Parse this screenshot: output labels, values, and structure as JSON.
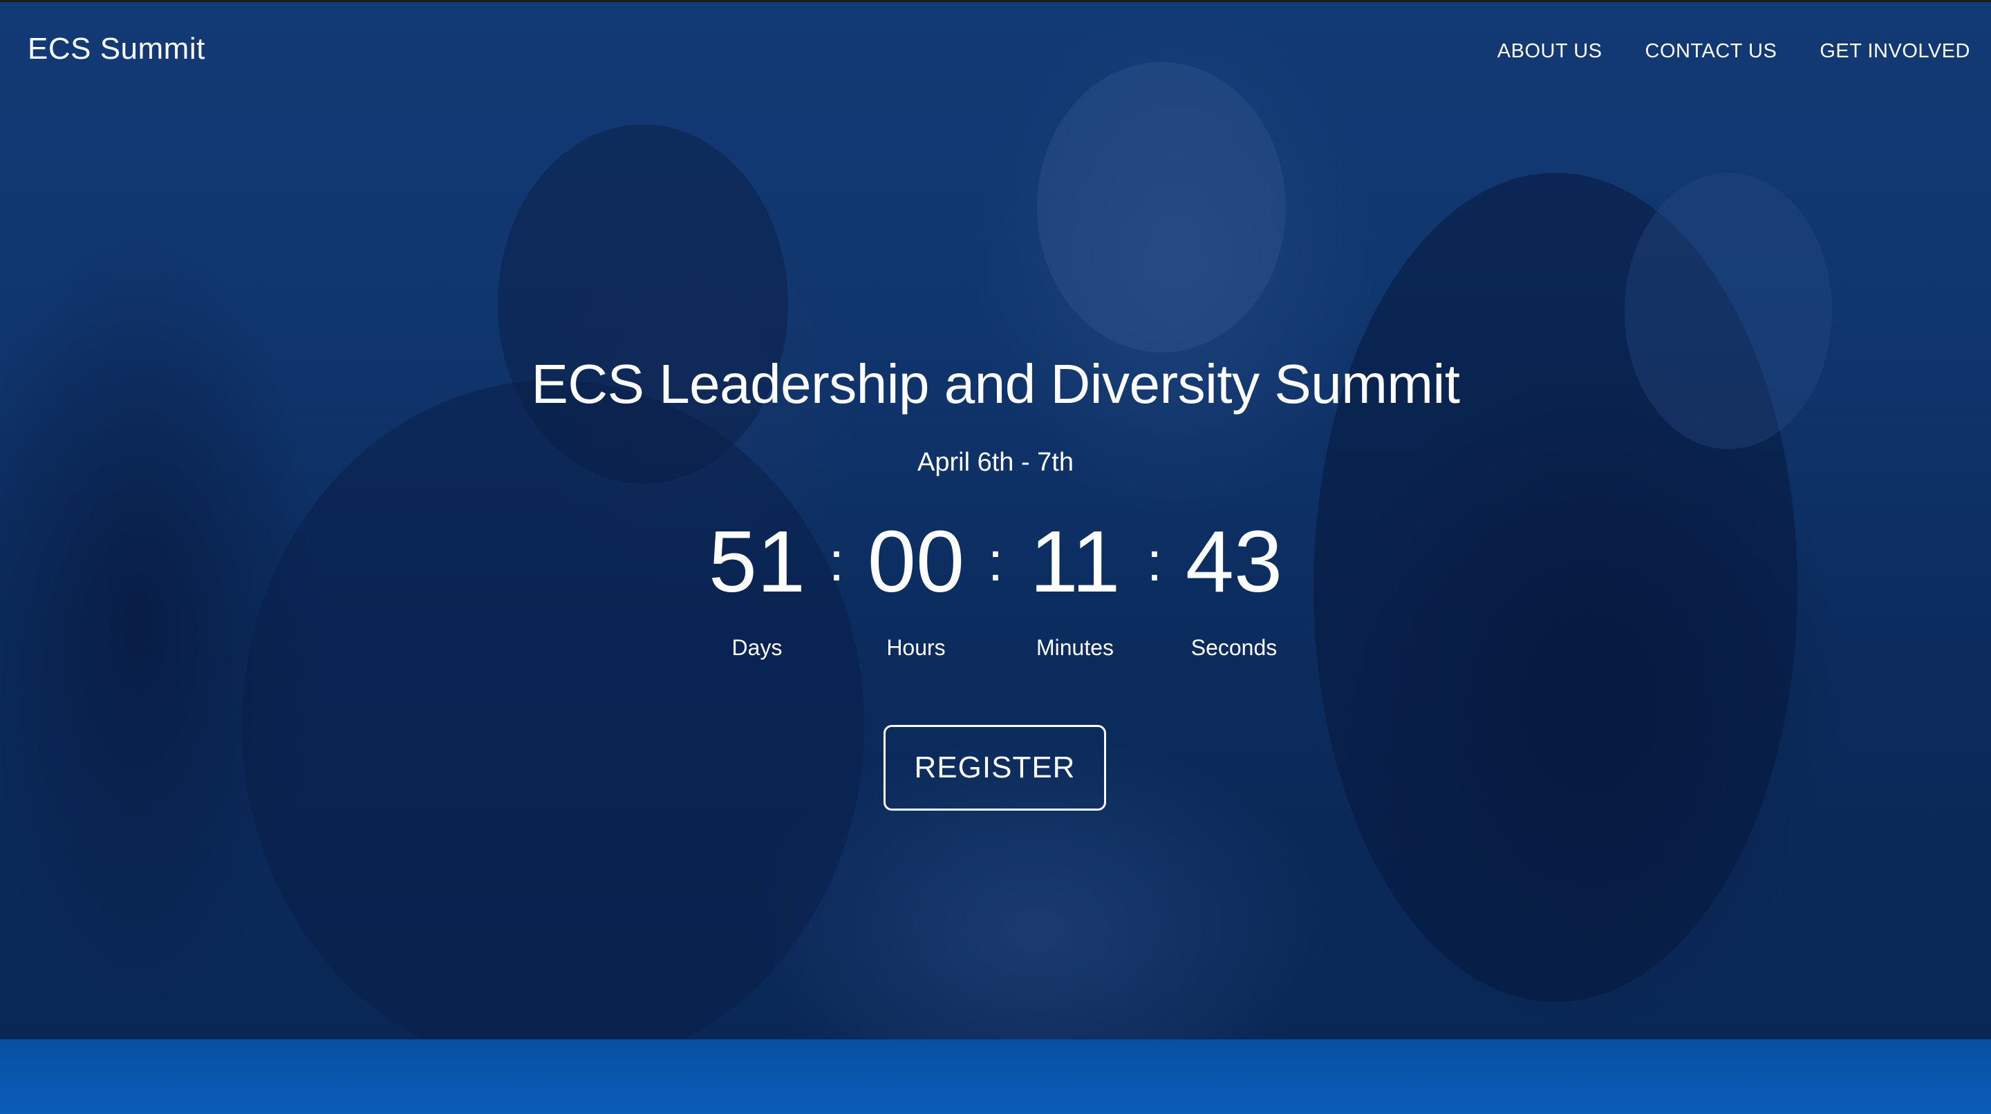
{
  "brand": "ECS Summit",
  "nav": {
    "items": [
      {
        "label": "ABOUT US"
      },
      {
        "label": "CONTACT US"
      },
      {
        "label": "GET INVOLVED"
      }
    ]
  },
  "hero": {
    "title": "ECS Leadership and Diversity Summit",
    "date": "April 6th - 7th",
    "countdown": {
      "separator": ":",
      "units": [
        {
          "value": "51",
          "label": "Days"
        },
        {
          "value": "00",
          "label": "Hours"
        },
        {
          "value": "11",
          "label": "Minutes"
        },
        {
          "value": "43",
          "label": "Seconds"
        }
      ]
    },
    "register_label": "REGISTER"
  },
  "colors": {
    "overlay": "#0b2f5e",
    "footer_band": "#0a5cb8",
    "text": "#ffffff"
  }
}
